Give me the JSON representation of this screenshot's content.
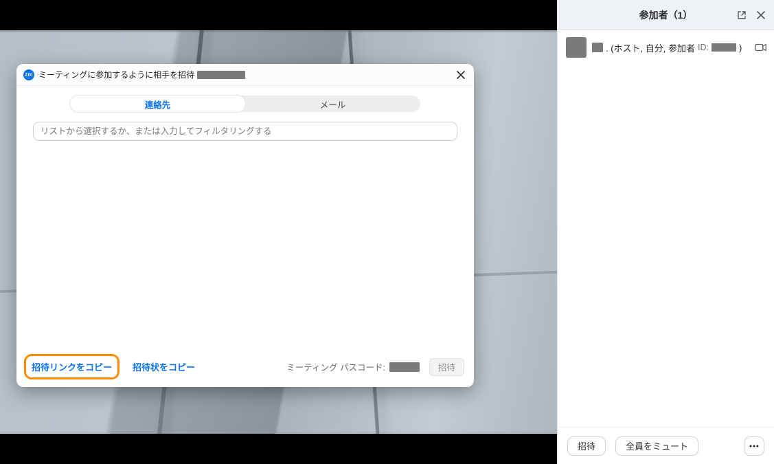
{
  "dialog": {
    "title_prefix": "ミーティングに参加するように相手を招待",
    "tabs": {
      "contacts": "連絡先",
      "mail": "メール",
      "active": "contacts"
    },
    "search_placeholder": "リストから選択するか、または入力してフィルタリングする",
    "copy_link": "招待リンクをコピー",
    "copy_invitation": "招待状をコピー",
    "passcode_label": "ミーティング パスコード:",
    "invite_button": "招待"
  },
  "panel": {
    "title": "参加者（1）",
    "participant_meta": ". (ホスト, 自分, 参加者",
    "participant_id_label": "ID:",
    "participant_meta_close": ")",
    "footer_invite": "招待",
    "footer_mute_all": "全員をミュート"
  },
  "icons": {
    "zm": "zm"
  }
}
